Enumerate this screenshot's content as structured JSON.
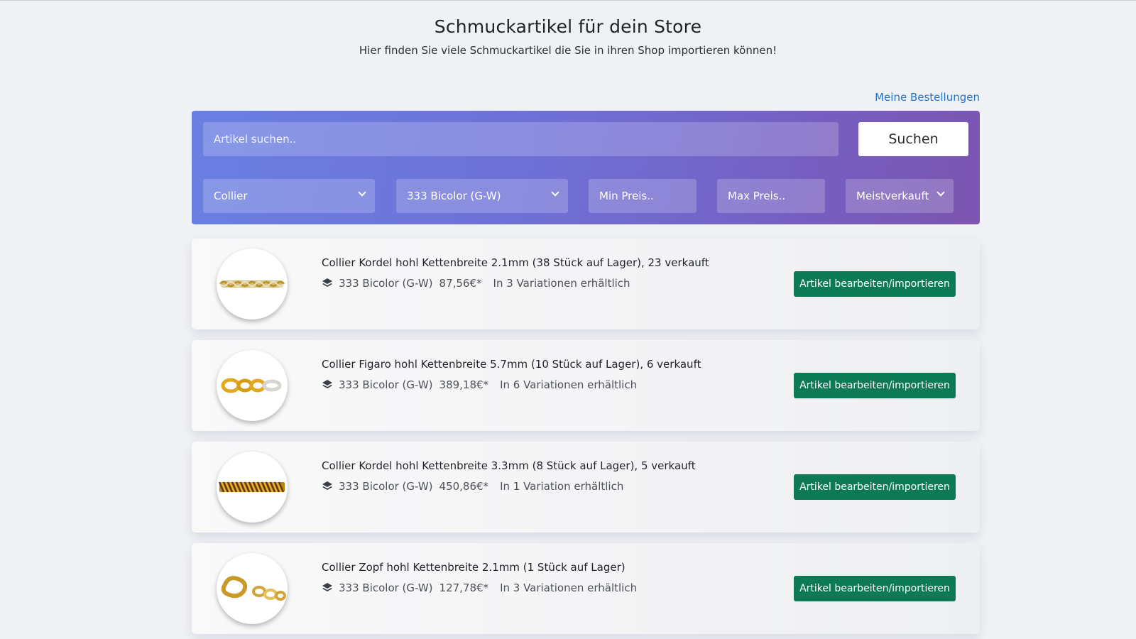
{
  "header": {
    "title": "Schmuckartikel für dein Store",
    "subtitle": "Hier finden Sie viele Schmuckartikel die Sie in ihren Shop importieren können!"
  },
  "nav": {
    "orders_link": "Meine Bestellungen"
  },
  "search": {
    "placeholder": "Artikel suchen..",
    "button_label": "Suchen"
  },
  "filters": {
    "category": "Collier",
    "material": "333 Bicolor (G-W)",
    "min_price_placeholder": "Min Preis..",
    "max_price_placeholder": "Max Preis..",
    "sort": "Meistverkauft"
  },
  "products": [
    {
      "title": "Collier Kordel hohl Kettenbreite 2.1mm (38 Stück auf Lager), 23 verkauft",
      "material": "333 Bicolor (G-W)",
      "price": "87,56€*",
      "variations": "In 3 Variationen erhältlich",
      "button_label": "Artikel bearbeiten/importieren"
    },
    {
      "title": "Collier Figaro hohl Kettenbreite 5.7mm (10 Stück auf Lager), 6 verkauft",
      "material": "333 Bicolor (G-W)",
      "price": "389,18€*",
      "variations": "In 6 Variationen erhältlich",
      "button_label": "Artikel bearbeiten/importieren"
    },
    {
      "title": "Collier Kordel hohl Kettenbreite 3.3mm (8 Stück auf Lager), 5 verkauft",
      "material": "333 Bicolor (G-W)",
      "price": "450,86€*",
      "variations": "In 1 Variation erhältlich",
      "button_label": "Artikel bearbeiten/importieren"
    },
    {
      "title": "Collier Zopf hohl Kettenbreite 2.1mm (1 Stück auf Lager)",
      "material": "333 Bicolor (G-W)",
      "price": "127,78€*",
      "variations": "In 3 Variationen erhältlich",
      "button_label": "Artikel bearbeiten/importieren"
    }
  ],
  "colors": {
    "accent_link": "#2574c9",
    "button_green": "#0e7a55",
    "panel_gradient_start": "#6a7fe2",
    "panel_gradient_end": "#7b55b0"
  },
  "icons": {
    "meta": "layers-icon",
    "dropdown": "chevron-down-icon"
  }
}
